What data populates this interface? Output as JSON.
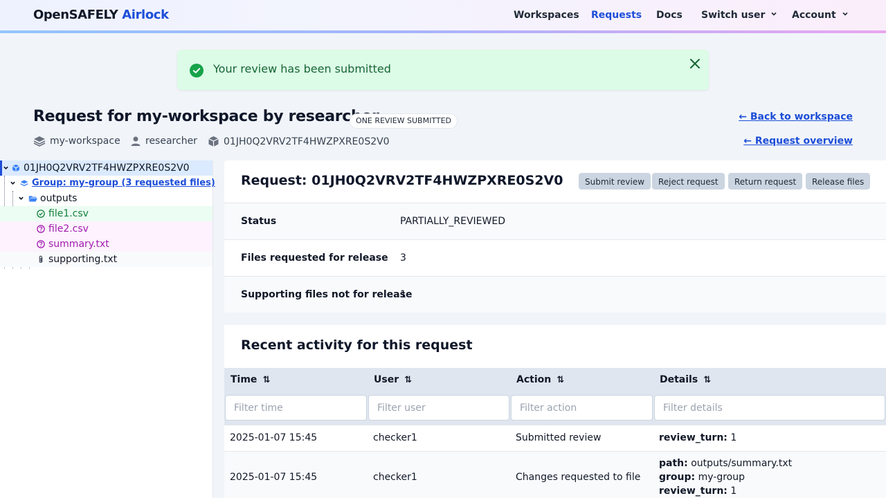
{
  "brand": {
    "prefix": "OpenSAFELY",
    "suffix": "Airlock"
  },
  "nav": {
    "workspaces": "Workspaces",
    "requests": "Requests",
    "docs": "Docs",
    "switch_user": "Switch user",
    "account": "Account"
  },
  "alert": {
    "message": "Your review has been submitted"
  },
  "request": {
    "title": "Request for my-workspace by researcher",
    "badge": "ONE REVIEW SUBMITTED",
    "workspace": "my-workspace",
    "author": "researcher",
    "id": "01JH0Q2VRV2TF4HWZPXRE0S2V0",
    "back_link": "← Back to workspace",
    "overview_link": "← Request overview"
  },
  "tree": {
    "root": "01JH0Q2VRV2TF4HWZPXRE0S2V0",
    "group": "Group: my-group (3 requested files)",
    "folder": "outputs",
    "files": [
      "file1.csv",
      "file2.csv",
      "summary.txt",
      "supporting.txt"
    ]
  },
  "panel": {
    "title": "Request: 01JH0Q2VRV2TF4HWZPXRE0S2V0",
    "buttons": {
      "submit": "Submit review",
      "reject": "Reject request",
      "return": "Return request",
      "release": "Release files"
    },
    "rows": [
      {
        "key": "Status",
        "value": "PARTIALLY_REVIEWED"
      },
      {
        "key": "Files requested for release",
        "value": "3"
      },
      {
        "key": "Supporting files not for release",
        "value": "1"
      }
    ]
  },
  "activity": {
    "title": "Recent activity for this request",
    "columns": [
      "Time",
      "User",
      "Action",
      "Details"
    ],
    "filters": [
      "Filter time",
      "Filter user",
      "Filter action",
      "Filter details"
    ],
    "rows": [
      {
        "time": "2025-01-07 15:45",
        "user": "checker1",
        "action": "Submitted review",
        "details": [
          {
            "k": "review_turn:",
            "v": "1"
          }
        ]
      },
      {
        "time": "2025-01-07 15:45",
        "user": "checker1",
        "action": "Changes requested to file",
        "details": [
          {
            "k": "path:",
            "v": "outputs/summary.txt"
          },
          {
            "k": "group:",
            "v": "my-group"
          },
          {
            "k": "review_turn:",
            "v": "1"
          }
        ]
      }
    ]
  },
  "colors": {
    "accent": "#1d4ed8",
    "approved": "#15803d",
    "pending": "#a21caf",
    "alert_bg": "#dcfce7"
  }
}
